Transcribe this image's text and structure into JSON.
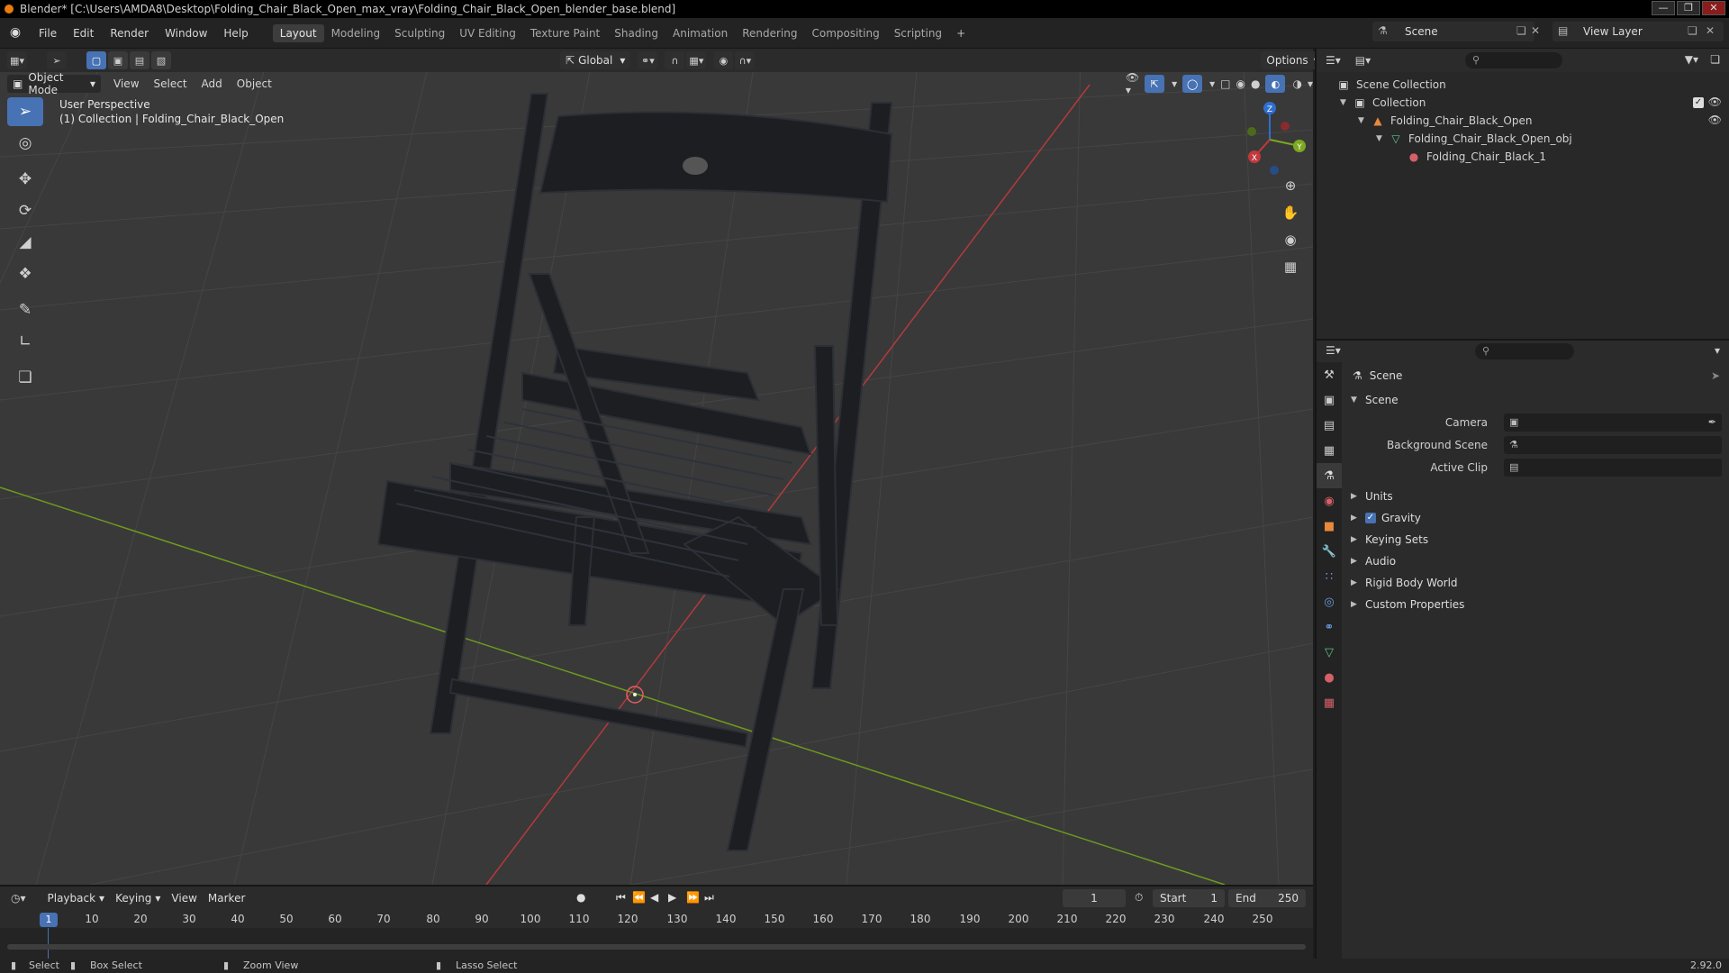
{
  "window": {
    "title": "Blender* [C:\\Users\\AMDA8\\Desktop\\Folding_Chair_Black_Open_max_vray\\Folding_Chair_Black_Open_blender_base.blend]"
  },
  "menu": [
    "File",
    "Edit",
    "Render",
    "Window",
    "Help"
  ],
  "workspaces": [
    "Layout",
    "Modeling",
    "Sculpting",
    "UV Editing",
    "Texture Paint",
    "Shading",
    "Animation",
    "Rendering",
    "Compositing",
    "Scripting"
  ],
  "scene": {
    "name": "Scene"
  },
  "view_layer": {
    "name": "View Layer"
  },
  "viewport": {
    "mode": "Object Mode",
    "menus": [
      "View",
      "Select",
      "Add",
      "Object"
    ],
    "transform_orientation": "Global",
    "options_label": "Options",
    "info_line1": "User Perspective",
    "info_line2": "(1) Collection | Folding_Chair_Black_Open",
    "gizmo_labels": {
      "x": "X",
      "y": "Y",
      "z": "Z"
    }
  },
  "outliner": {
    "items": [
      {
        "label": "Scene Collection"
      },
      {
        "label": "Collection"
      },
      {
        "label": "Folding_Chair_Black_Open"
      },
      {
        "label": "Folding_Chair_Black_Open_obj"
      },
      {
        "label": "Folding_Chair_Black_1"
      }
    ]
  },
  "properties": {
    "context_title": "Scene",
    "panel_title": "Scene",
    "fields": [
      {
        "label": "Camera",
        "value": ""
      },
      {
        "label": "Background Scene",
        "value": ""
      },
      {
        "label": "Active Clip",
        "value": ""
      }
    ],
    "subpanels": [
      "Units",
      "Gravity",
      "Keying Sets",
      "Audio",
      "Rigid Body World",
      "Custom Properties"
    ]
  },
  "timeline": {
    "menus": [
      "Playback",
      "Keying",
      "View",
      "Marker"
    ],
    "current_frame": "1",
    "start_label": "Start",
    "start": "1",
    "end_label": "End",
    "end": "250",
    "ticks": [
      "10",
      "20",
      "30",
      "40",
      "50",
      "60",
      "70",
      "80",
      "90",
      "100",
      "110",
      "120",
      "130",
      "140",
      "150",
      "160",
      "170",
      "180",
      "190",
      "200",
      "210",
      "220",
      "230",
      "240",
      "250"
    ]
  },
  "statusbar": {
    "select": "Select",
    "box_select": "Box Select",
    "zoom_view": "Zoom View",
    "lasso_select": "Lasso Select",
    "version": "2.92.0"
  },
  "colors": {
    "accent": "#4772b3",
    "x_axis": "#c0393c",
    "y_axis": "#7da81f",
    "z_axis": "#2f6fd0"
  }
}
